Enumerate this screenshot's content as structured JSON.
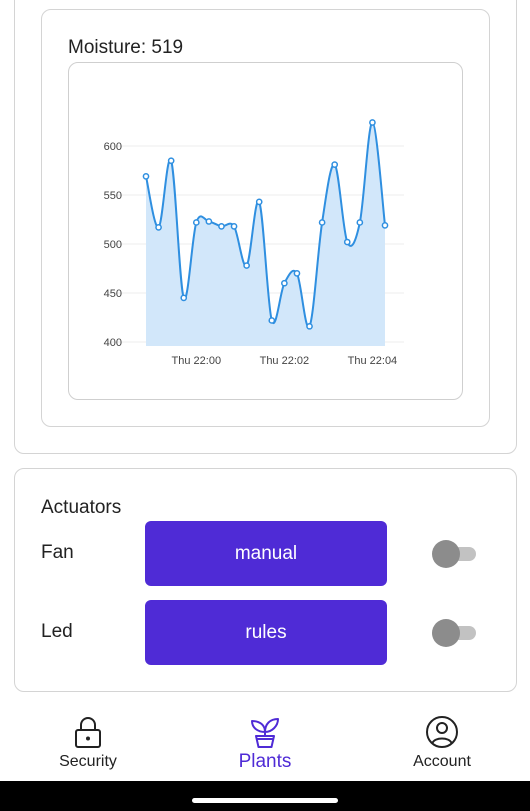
{
  "moisture": {
    "label": "Moisture: 519"
  },
  "chart_data": {
    "type": "area",
    "title": "",
    "xlabel": "",
    "ylabel": "",
    "ylim": [
      397,
      660
    ],
    "yticks": [
      "600",
      "550",
      "500",
      "450",
      "400"
    ],
    "ytick_values": [
      600,
      550,
      500,
      450,
      400
    ],
    "xticks": [
      "Thu 22:00",
      "Thu 22:02",
      "Thu 22:04"
    ],
    "xtick_positions": [
      4,
      11,
      18
    ],
    "grid": true,
    "series": [
      {
        "values": [
          569,
          517,
          585,
          445,
          522,
          523,
          518,
          518,
          478,
          543,
          422,
          460,
          470,
          416,
          522,
          581,
          502,
          522,
          624,
          519
        ]
      }
    ],
    "line_color": "#2f8fe0",
    "fill_color": "#d2e7fa"
  },
  "actuators": {
    "title": "Actuators",
    "rows": [
      {
        "label": "Fan",
        "mode": "manual",
        "enabled": false
      },
      {
        "label": "Led",
        "mode": "rules",
        "enabled": false
      }
    ]
  },
  "nav": {
    "items": [
      {
        "label": "Security",
        "icon": "lock-icon",
        "active": false
      },
      {
        "label": "Plants",
        "icon": "plant-icon",
        "active": true
      },
      {
        "label": "Account",
        "icon": "account-icon",
        "active": false
      }
    ],
    "accent": "#4f2bd6"
  }
}
